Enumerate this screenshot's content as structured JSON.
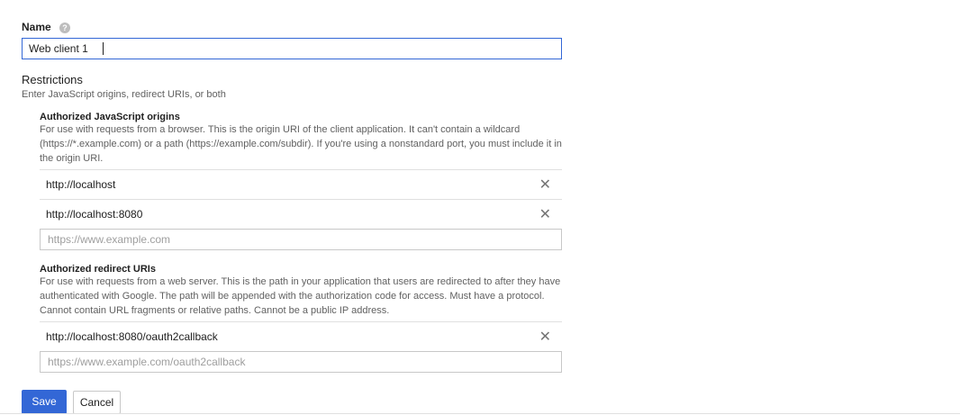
{
  "form": {
    "name_label": "Name",
    "help_icon_glyph": "?",
    "name_value": "Web client 1",
    "restrictions_title": "Restrictions",
    "restrictions_sub": "Enter JavaScript origins, redirect URIs, or both"
  },
  "origins": {
    "title": "Authorized JavaScript origins",
    "description": "For use with requests from a browser. This is the origin URI of the client application. It can't contain a wildcard (https://*.example.com) or a path (https://example.com/subdir). If you're using a nonstandard port, you must include it in the origin URI.",
    "items": [
      "http://localhost",
      "http://localhost:8080"
    ],
    "placeholder": "https://www.example.com",
    "remove_glyph": "✕"
  },
  "redirects": {
    "title": "Authorized redirect URIs",
    "description": "For use with requests from a web server. This is the path in your application that users are redirected to after they have authenticated with Google. The path will be appended with the authorization code for access. Must have a protocol. Cannot contain URL fragments or relative paths. Cannot be a public IP address.",
    "items": [
      "http://localhost:8080/oauth2callback"
    ],
    "placeholder": "https://www.example.com/oauth2callback",
    "remove_glyph": "✕"
  },
  "actions": {
    "save_label": "Save",
    "cancel_label": "Cancel"
  },
  "colors": {
    "accent": "#3367d6"
  }
}
